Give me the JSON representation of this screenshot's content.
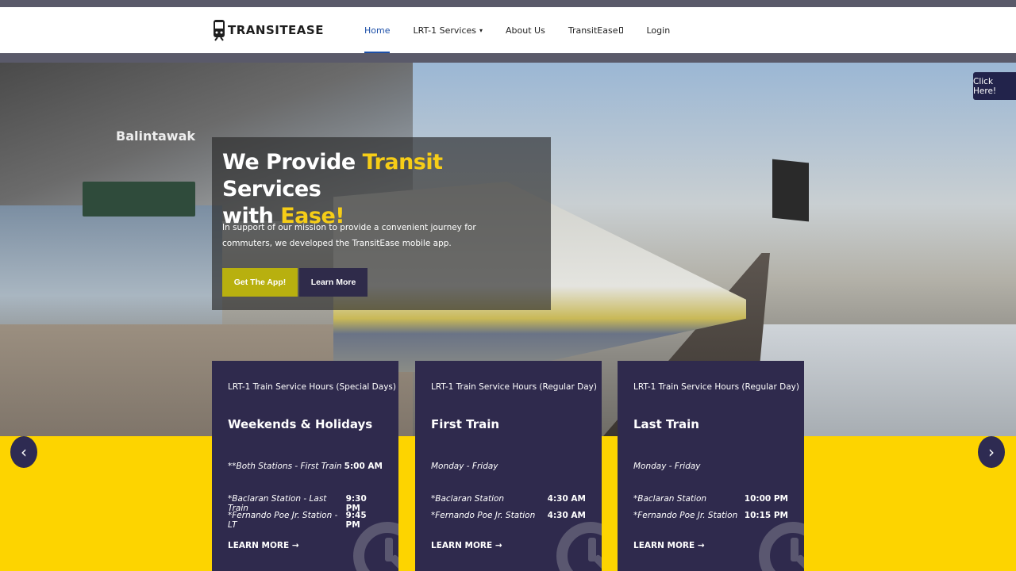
{
  "header": {
    "logo_text": "TRANSITEASE",
    "nav": [
      "Home",
      "LRT-1 Services",
      "About Us",
      "TransitEase",
      "Login"
    ]
  },
  "hero": {
    "headline_part1": "We Provide ",
    "headline_hl1": "Transit",
    "headline_part2": " Services",
    "headline_part3": "with ",
    "headline_hl2": "Ease!",
    "subtext": "In support of our mission to provide a convenient journey for commuters, we developed the TransitEase mobile app.",
    "btn_app": "Get The App!",
    "btn_learn": "Learn More",
    "station_sign": "Balintawak",
    "click_here": "Click Here!"
  },
  "carousel": {
    "prev": "‹",
    "next": "›"
  },
  "cards": [
    {
      "title": "LRT-1 Train Service Hours (Special Days)",
      "heading": "Weekends & Holidays",
      "rows": [
        {
          "label": "**Both Stations - First Train",
          "time": "5:00 AM"
        },
        {
          "label": "*Baclaran Station - Last Train",
          "time": "9:30 PM"
        },
        {
          "label": "*Fernando Poe Jr. Station - LT",
          "time": "9:45 PM"
        }
      ],
      "more": "LEARN MORE"
    },
    {
      "title": "LRT-1 Train Service Hours (Regular Day)",
      "heading": "First Train",
      "rows": [
        {
          "label": "Monday - Friday",
          "time": ""
        },
        {
          "label": "*Baclaran Station",
          "time": "4:30 AM"
        },
        {
          "label": "*Fernando Poe Jr. Station",
          "time": "4:30 AM"
        }
      ],
      "more": "LEARN MORE"
    },
    {
      "title": "LRT-1 Train Service Hours (Regular Day)",
      "heading": "Last Train",
      "rows": [
        {
          "label": "Monday - Friday",
          "time": ""
        },
        {
          "label": "*Baclaran Station",
          "time": "10:00 PM"
        },
        {
          "label": "*Fernando Poe Jr. Station",
          "time": "10:15 PM"
        }
      ],
      "more": "LEARN MORE"
    }
  ],
  "colors": {
    "accent_yellow": "#fdd400",
    "headline_highlight": "#f6cd17",
    "card_bg": "#2f2a4d",
    "nav_active": "#1c4fa8"
  }
}
